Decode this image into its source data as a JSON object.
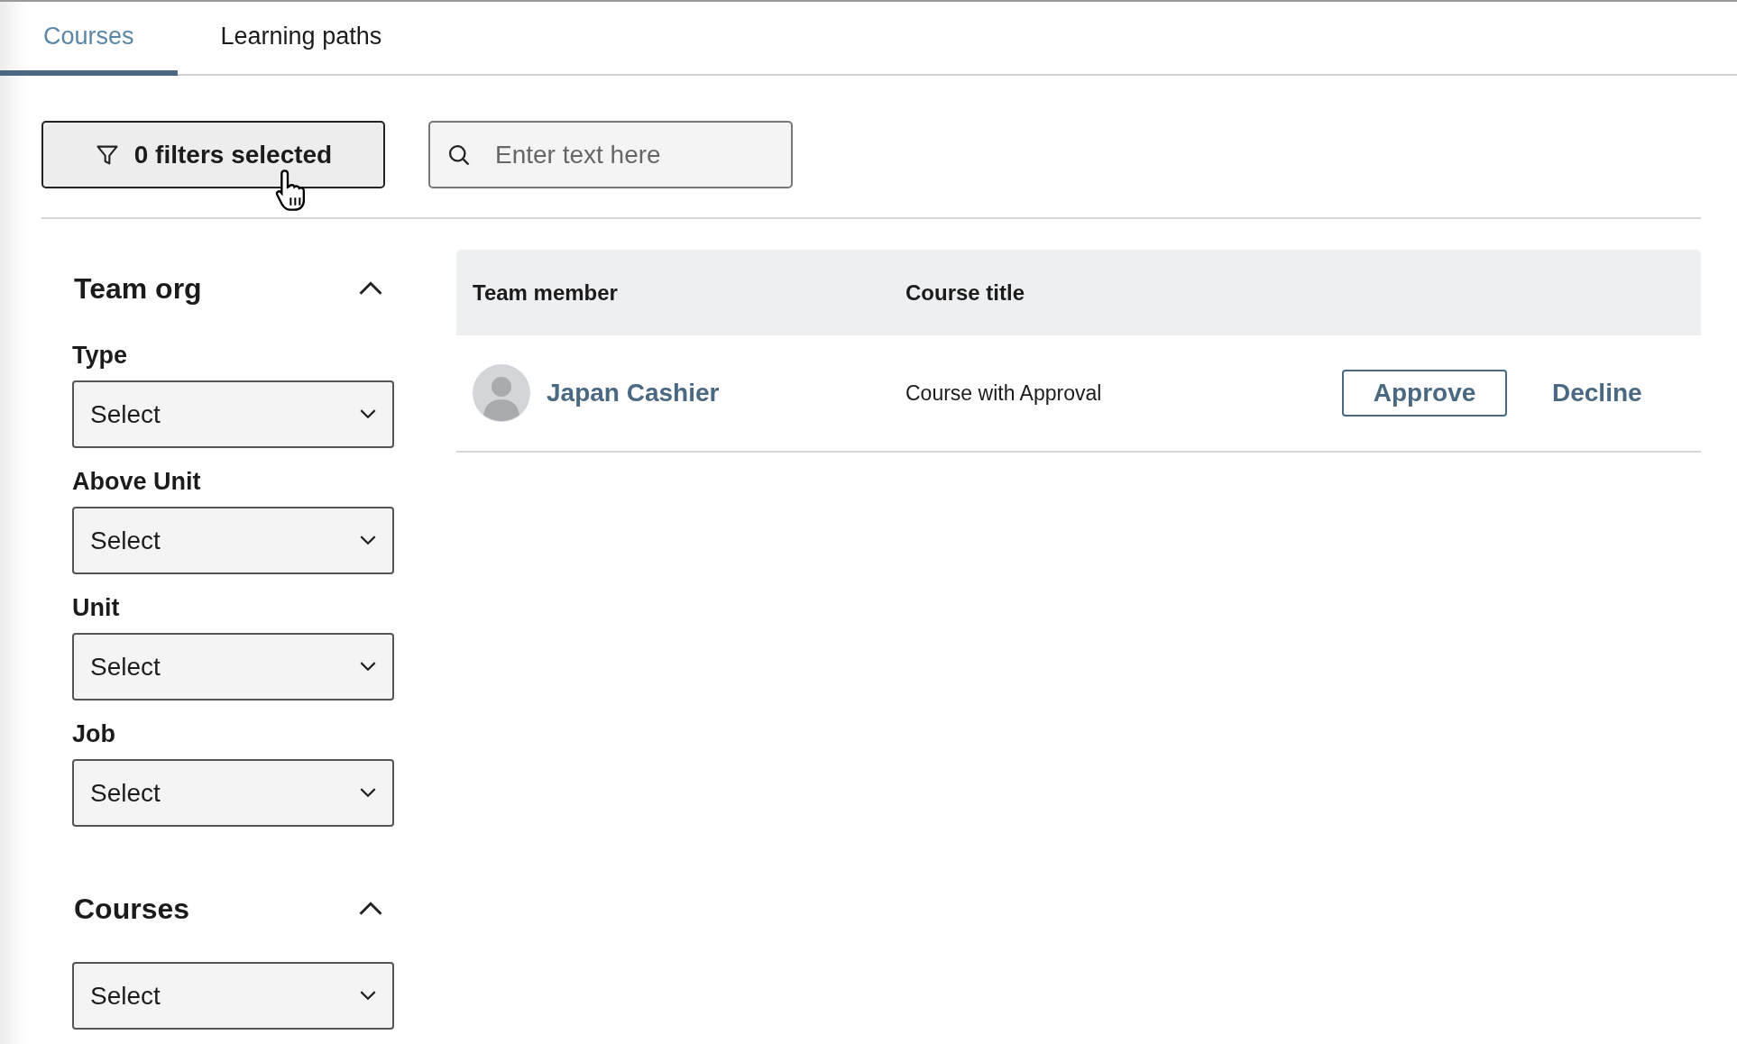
{
  "tabs": [
    {
      "label": "Courses",
      "selected": true
    },
    {
      "label": "Learning paths",
      "selected": false
    }
  ],
  "filter_button": {
    "label": "0 filters selected"
  },
  "search": {
    "placeholder": "Enter text here"
  },
  "sidebar": {
    "sections": [
      {
        "title": "Team org",
        "expanded": true,
        "fields": [
          {
            "label": "Type",
            "value": "Select"
          },
          {
            "label": "Above Unit",
            "value": "Select"
          },
          {
            "label": "Unit",
            "value": "Select"
          },
          {
            "label": "Job",
            "value": "Select"
          }
        ]
      },
      {
        "title": "Courses",
        "expanded": true,
        "fields": [
          {
            "value": "Select"
          }
        ]
      }
    ]
  },
  "table": {
    "columns": [
      "Team member",
      "Course title"
    ],
    "rows": [
      {
        "member": "Japan Cashier",
        "course": "Course with Approval",
        "actions": [
          {
            "label": "Approve",
            "kind": "outlined"
          },
          {
            "label": "Decline",
            "kind": "text"
          }
        ]
      }
    ]
  }
}
